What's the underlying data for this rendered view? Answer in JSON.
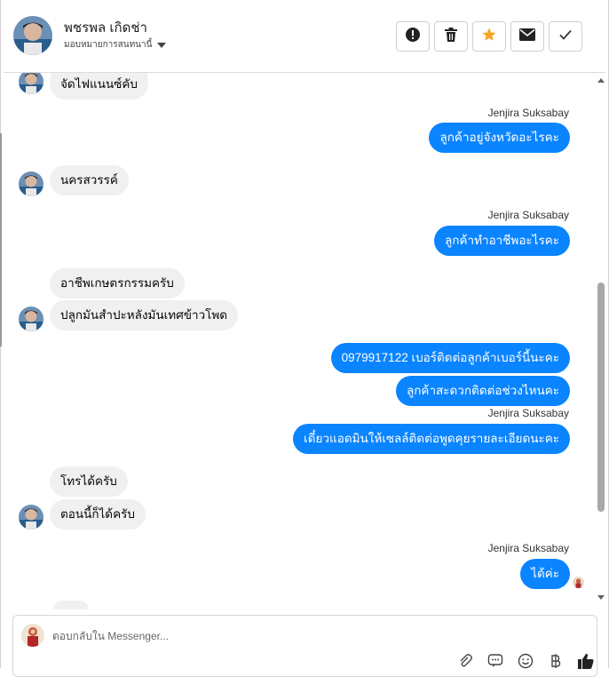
{
  "header": {
    "contact_name": "พชรพล เกิดช่า",
    "assign_label": "มอบหมายการสนทนานี้"
  },
  "actions": [
    "alert-icon",
    "trash-icon",
    "star-icon",
    "mail-icon",
    "check-icon"
  ],
  "colors": {
    "outgoing": "#0a84ff",
    "incoming": "#f0f0f0",
    "star": "#f5a623"
  },
  "messages": {
    "m1": "จัดไฟแนนซ์คับ",
    "s1": "Jenjira Suksabay",
    "m2": "ลูกค้าอยู่จังหวัดอะไรคะ",
    "m3": "นครสวรรค์",
    "s2": "Jenjira Suksabay",
    "m4": "ลูกค้าทำอาชีพอะไรคะ",
    "m5": "อาชีพเกษตรกรรมครับ",
    "m6": "ปลูกมันสำปะหลังมันเทศข้าวโพด",
    "m7": "0979917122 เบอร์ติดต่อลูกค้าเบอร์นี้นะคะ",
    "m8": "ลูกค้าสะดวกติดต่อช่วงไหนคะ",
    "s3": "Jenjira Suksabay",
    "m9": "เดี๋ยวแอดมินให้เซลล์ติดต่อพูดคุยรายละเอียดนะคะ",
    "m10": "โทรได้ครับ",
    "m11": "ตอนนี้ก็ได้ครับ",
    "s4": "Jenjira Suksabay",
    "m12": "ได้ค่ะ"
  },
  "composer": {
    "placeholder": "ตอบกลับใน Messenger...",
    "tools": [
      "paperclip-icon",
      "sticker-icon",
      "emoji-icon",
      "baht-icon",
      "thumbs-up-icon"
    ]
  }
}
